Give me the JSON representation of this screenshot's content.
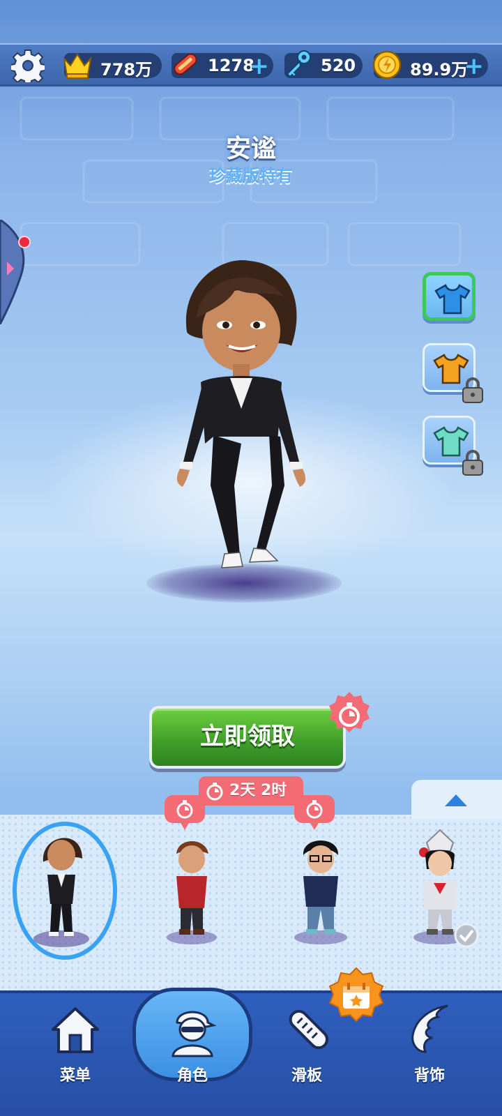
{
  "status_bar": {
    "trophies": "778万",
    "hoverboards": "1278",
    "keys": "520",
    "coins": "89.9万",
    "plus_symbol": "+"
  },
  "character": {
    "name": "安谧",
    "subtitle": "珍藏版特有"
  },
  "outfits": [
    {
      "color": "#2d8fe6",
      "locked": false,
      "selected": true
    },
    {
      "color": "#f2a21e",
      "locked": true,
      "selected": false
    },
    {
      "color": "#6fdcc6",
      "locked": true,
      "selected": false
    }
  ],
  "claim": {
    "button_label": "立即领取",
    "time_remaining": "2天 2时"
  },
  "character_strip": {
    "items": [
      "selected",
      "timed",
      "timed",
      "owned"
    ]
  },
  "nav": {
    "items": [
      {
        "label": "菜单",
        "icon": "house-icon"
      },
      {
        "label": "角色",
        "icon": "character-icon"
      },
      {
        "label": "滑板",
        "icon": "hoverboard-icon"
      },
      {
        "label": "背饰",
        "icon": "wings-icon"
      }
    ],
    "active_index": 1
  },
  "colors": {
    "accent_green": "#3f9d2a",
    "timer_red": "#f36b75",
    "nav_blue": "#2f5fbe",
    "selection_blue": "#3aa2f3",
    "badge_orange": "#f7941d"
  }
}
